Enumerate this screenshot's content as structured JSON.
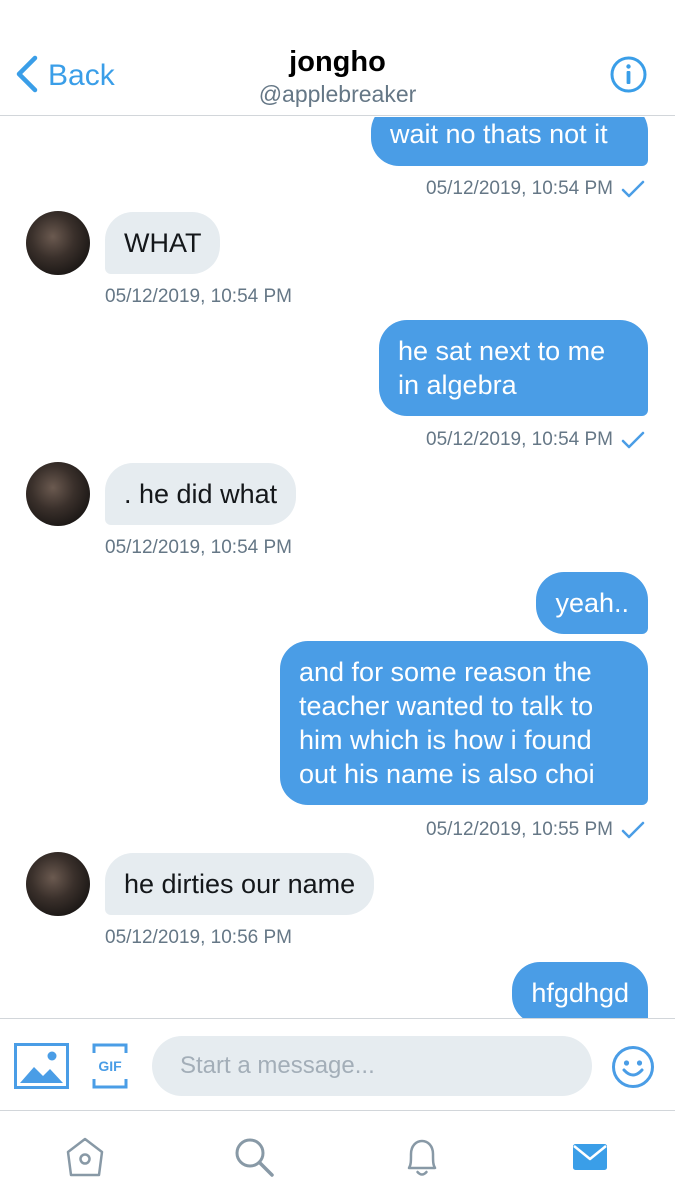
{
  "header": {
    "back_label": "Back",
    "name": "jongho",
    "handle": "@applebreaker",
    "back_icon": "chevron-left-icon",
    "info_icon": "info-icon"
  },
  "messages": [
    {
      "dir": "out",
      "text": "wait no thats not it",
      "time": "05/12/2019, 10:54 PM"
    },
    {
      "dir": "in",
      "text": "WHAT",
      "time": "05/12/2019, 10:54 PM"
    },
    {
      "dir": "out",
      "text": "he sat next to me in algebra",
      "time": "05/12/2019, 10:54 PM"
    },
    {
      "dir": "in",
      "text": ". he did what",
      "time": "05/12/2019, 10:54 PM"
    },
    {
      "dir": "out",
      "text": "yeah..",
      "time": ""
    },
    {
      "dir": "out",
      "text": "and for some reason the teacher wanted to talk to him which is how i found out his name is also choi",
      "time": "05/12/2019, 10:55 PM"
    },
    {
      "dir": "in",
      "text": "he dirties our name",
      "time": "05/12/2019, 10:56 PM"
    },
    {
      "dir": "out",
      "text": "hfgdhgd",
      "time": ""
    }
  ],
  "composer": {
    "placeholder": "Start a message...",
    "image_icon": "image-icon",
    "gif_label": "GIF",
    "emoji_icon": "emoji-icon"
  },
  "tabs": [
    "home-icon",
    "search-icon",
    "notifications-icon",
    "messages-icon"
  ],
  "colors": {
    "accent": "#4a9de6",
    "incoming_bubble": "#e6ecf0",
    "timestamp": "#657786",
    "active_tab": "#3a9ee8",
    "inactive_tab": "#8899a6"
  }
}
